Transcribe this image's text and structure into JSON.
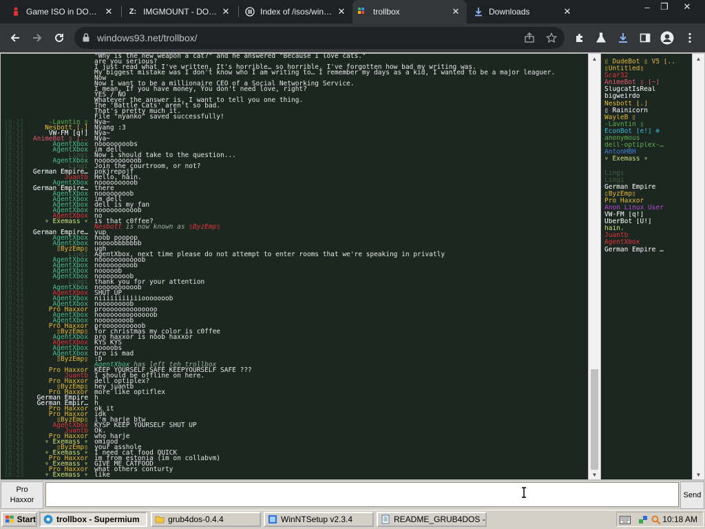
{
  "browser": {
    "tabs": [
      {
        "title": "Game ISO in DOSBox",
        "icon": "red-figure-icon",
        "active": false
      },
      {
        "title": "IMGMOUNT - DOSBox",
        "icon": "z-icon",
        "active": false
      },
      {
        "title": "Index of /isos/windows",
        "icon": "archive-icon",
        "active": false
      },
      {
        "title": "trollbox",
        "icon": "windows93-icon",
        "active": true
      },
      {
        "title": "Downloads",
        "icon": "download-icon",
        "active": false
      }
    ],
    "window_controls": {
      "minimize": "‒",
      "restore": "❐",
      "close": "✕"
    },
    "url": "windows93.net/trollbox/"
  },
  "chat": {
    "lines": [
      {
        "t": "",
        "nick": "",
        "nc": "#e7e7e7",
        "msg": "\"Why is the new weapon a cat?\" and he answered \"Because I love cats.\""
      },
      {
        "t": "",
        "nick": "",
        "nc": "#e7e7e7",
        "msg": "  are you serious?"
      },
      {
        "t": "",
        "nick": "",
        "nc": "#e7e7e7",
        "msg": "I just read what I've written, It's horrible… so horrible. I've forgotten how bad my writing was."
      },
      {
        "t": "",
        "nick": "",
        "nc": "#e7e7e7",
        "msg": "My biggest mistake was I don't know who I am writing to… I remember my days as a kid, I wanted to be a major leaguer."
      },
      {
        "t": "",
        "nick": "",
        "nc": "#e7e7e7",
        "msg": "Now"
      },
      {
        "t": "",
        "nick": "",
        "nc": "#e7e7e7",
        "msg": "Now I want to be a millionaire CEO of a Social Networking Service."
      },
      {
        "t": "",
        "nick": "",
        "nc": "#e7e7e7",
        "msg": "I mean, If you have money, You don't need love, right?"
      },
      {
        "t": "",
        "nick": "",
        "nc": "#e7e7e7",
        "msg": "YES / NO"
      },
      {
        "t": "",
        "nick": "",
        "nc": "#e7e7e7",
        "msg": "Whatever the answer is, I want to tell you one thing."
      },
      {
        "t": "",
        "nick": "",
        "nc": "#e7e7e7",
        "msg": "The 'Battle Cats' aren't so bad."
      },
      {
        "t": "",
        "nick": "",
        "nc": "#e7e7e7",
        "msg": "That's pretty much it."
      },
      {
        "t": "",
        "nick": "",
        "nc": "#e7e7e7",
        "msg": "File \"nyanko\" saved successfully!"
      },
      {
        "t": "10:21",
        "nick": "-Lavntin ▯",
        "nc": "#5fb14d",
        "msg": "Nya~"
      },
      {
        "t": "10:21",
        "nick": "Nesbott [.]",
        "nc": "#e3b93a",
        "msg": "Nyang :3"
      },
      {
        "t": "10:21",
        "nick": "VW-FM [q!]",
        "nc": "#ffffff",
        "msg": "Nya~"
      },
      {
        "t": "10:21",
        "nick": "AnimeBot ▯ [..",
        "nc": "#e2596a",
        "msg": "Nya~"
      },
      {
        "t": "10:21",
        "nick": "AgentXbox",
        "nc": "#4fbe8f",
        "msg": "noooooooobs"
      },
      {
        "t": "10:21",
        "nick": "AgentXbox",
        "nc": "#4fbe8f",
        "msg": "im dell"
      },
      {
        "t": "10:21",
        "nick": "Lingi",
        "nc": "#3f5f40",
        "msg": "Now i should take to the question..."
      },
      {
        "t": "10:21",
        "nick": "AgentXbox",
        "nc": "#4fbe8f",
        "msg": "noooooooooob"
      },
      {
        "t": "10:21",
        "nick": "Lingi",
        "nc": "#3f5f40",
        "msg": "Join the courtroom, or not?"
      },
      {
        "t": "10:21",
        "nick": "German Empire…",
        "nc": "#ffffff",
        "msg": "pokjrepojf"
      },
      {
        "t": "10:21",
        "nick": "Juantb",
        "nc": "#e2333b",
        "msg": "Hello, hain."
      },
      {
        "t": "10:21",
        "nick": "AgentXbox",
        "nc": "#4fbe8f",
        "msg": "nooooooooob"
      },
      {
        "t": "10:21",
        "nick": "German Empire…",
        "nc": "#ffffff",
        "msg": "there"
      },
      {
        "t": "10:21",
        "nick": "AgentXbox",
        "nc": "#4fbe8f",
        "msg": "noooooooob"
      },
      {
        "t": "10:21",
        "nick": "AgentXbox",
        "nc": "#4fbe8f",
        "msg": "im dell"
      },
      {
        "t": "10:21",
        "nick": "AgentXbox",
        "nc": "#4fbe8f",
        "msg": "dell is my fan"
      },
      {
        "t": "10:21",
        "nick": "AgentXbox",
        "nc": "#4fbe8f",
        "msg": "noooooooooob"
      },
      {
        "t": "10:21",
        "nick": "AgentXbox",
        "nc": "#e2333b",
        "msg": "no"
      },
      {
        "t": "10:21",
        "nick": "▿ Exemass ▿",
        "nc": "#cfe07a",
        "msg": "is that c0ffee?"
      },
      {
        "t": "10:21",
        "nick": "",
        "nc": "#e7e7e7",
        "msg": "",
        "sys": {
          "a": "Nesbott",
          "ac": "#e2333b",
          "text": " is now known as ",
          "b": "▯ByzEmp▯",
          "bc": "#e2333b"
        }
      },
      {
        "t": "10:21",
        "nick": "German Empire…",
        "nc": "#ffffff",
        "msg": "yup"
      },
      {
        "t": "10:21",
        "nick": "AgentXbox",
        "nc": "#4fbe8f",
        "msg": "noob poopop"
      },
      {
        "t": "10:21",
        "nick": "AgentXbox",
        "nc": "#4fbe8f",
        "msg": "noooobbbbbbb"
      },
      {
        "t": "10:21",
        "nick": "▯ByzEmp▯",
        "nc": "#e3b93a",
        "msg": "ugh"
      },
      {
        "t": "10:21",
        "nick": "Lingi",
        "nc": "#3f5f40",
        "msg": "AgentXbox, next time please do not attempt to enter rooms that we're speaking in privatly"
      },
      {
        "t": "10:21",
        "nick": "AgentXbox",
        "nc": "#4fbe8f",
        "msg": "nooooooooooob"
      },
      {
        "t": "10:21",
        "nick": "AgentXbox",
        "nc": "#4fbe8f",
        "msg": "nooooooooob"
      },
      {
        "t": "10:21",
        "nick": "AgentXbox",
        "nc": "#4fbe8f",
        "msg": "nooooob"
      },
      {
        "t": "10:21",
        "nick": "AgentXbox",
        "nc": "#4fbe8f",
        "msg": "noooooooob"
      },
      {
        "t": "10:21",
        "nick": "Lingi",
        "nc": "#3f5f40",
        "msg": "thank you for your attention"
      },
      {
        "t": "10:21",
        "nick": "AgentXbox",
        "nc": "#4fbe8f",
        "msg": "noooooooooob"
      },
      {
        "t": "10:22",
        "nick": "AgentXbox",
        "nc": "#e2333b",
        "msg": "SHUT UP"
      },
      {
        "t": "10:22",
        "nick": "AgentXbox",
        "nc": "#4fbe8f",
        "msg": "niiiiiiiiiiiooooooob"
      },
      {
        "t": "10:22",
        "nick": "AgentXbox",
        "nc": "#4fbe8f",
        "msg": "noooooooob"
      },
      {
        "t": "10:22",
        "nick": "Pro Haxxor",
        "nc": "#e3b93a",
        "msg": "proooooooooooooo"
      },
      {
        "t": "10:22",
        "nick": "AgentXbox",
        "nc": "#4fbe8f",
        "msg": "noooooooooooooob"
      },
      {
        "t": "10:22",
        "nick": "AgentXbox",
        "nc": "#4fbe8f",
        "msg": "noooooooob"
      },
      {
        "t": "10:22",
        "nick": "Pro Haxxor",
        "nc": "#e3b93a",
        "msg": "proooooooooob"
      },
      {
        "t": "10:22",
        "nick": "▯ByzEmp▯",
        "nc": "#e3b93a",
        "msg": "for christmas my color is c0ffee"
      },
      {
        "t": "10:22",
        "nick": "AgentXbox",
        "nc": "#4fbe8f",
        "msg": "pro haxxor is noob haxxor"
      },
      {
        "t": "10:22",
        "nick": "AgentXbox",
        "nc": "#e2333b",
        "msg": "KYS KYS"
      },
      {
        "t": "10:22",
        "nick": "AgentXbox",
        "nc": "#4fbe8f",
        "msg": "noooobs"
      },
      {
        "t": "10:22",
        "nick": "AgentXbox",
        "nc": "#4fbe8f",
        "msg": "bro is mad"
      },
      {
        "t": "10:22",
        "nick": "▯ByzEmp▯",
        "nc": "#e3b93a",
        "msg": ":D"
      },
      {
        "t": "10:22",
        "nick": "",
        "nc": "#e7e7e7",
        "msg": "",
        "sys": {
          "a": "AgentXbox",
          "ac": "#4fbe8f",
          "text": " has left teh trollbox",
          "b": "",
          "bc": "#e2333b"
        }
      },
      {
        "t": "10:22",
        "nick": "Pro Haxxor",
        "nc": "#e3b93a",
        "msg": "KEEP YOURSELF SAFE KEEPYOURSELF SAFE ???"
      },
      {
        "t": "10:22",
        "nick": "Juantb",
        "nc": "#e2333b",
        "msg": "I should be offline on here."
      },
      {
        "t": "10:22",
        "nick": "Pro Haxxor",
        "nc": "#e3b93a",
        "msg": "dell optiplex?"
      },
      {
        "t": "10:22",
        "nick": "▯ByzEmp▯",
        "nc": "#e3b93a",
        "msg": "hey juantb"
      },
      {
        "t": "10:22",
        "nick": "Pro Haxxor",
        "nc": "#e3b93a",
        "msg": "more like optiflex"
      },
      {
        "t": "10:22",
        "nick": "German Empire",
        "nc": "#ffffff",
        "msg": "h"
      },
      {
        "t": "10:22",
        "nick": "German Empir…",
        "nc": "#ffffff",
        "msg": "h"
      },
      {
        "t": "10:22",
        "nick": "Pro Haxxor",
        "nc": "#e3b93a",
        "msg": "ok it"
      },
      {
        "t": "10:22",
        "nick": "Pro Haxxor",
        "nc": "#e3b93a",
        "msg": "idk"
      },
      {
        "t": "10:22",
        "nick": "▯ByzEmp▯",
        "nc": "#e3b93a",
        "msg": "i'm harje btw"
      },
      {
        "t": "10:22",
        "nick": "AgentXbox",
        "nc": "#e2333b",
        "msg": "KYSP KEEP YOURSELF SHUT UP"
      },
      {
        "t": "10:22",
        "nick": "Juantb",
        "nc": "#e2333b",
        "msg": "Ok."
      },
      {
        "t": "10:22",
        "nick": "Pro Haxxor",
        "nc": "#e3b93a",
        "msg": "who harje"
      },
      {
        "t": "10:23",
        "nick": "▿ Exemass ▿",
        "nc": "#cfe07a",
        "msg": "omigod"
      },
      {
        "t": "10:23",
        "nick": "▯ByzEmp▯",
        "nc": "#e3b93a",
        "msg": "your asshole"
      },
      {
        "t": "10:23",
        "nick": "▿ Exemass ▿",
        "nc": "#cfe07a",
        "msg": "I need cat food QUICK"
      },
      {
        "t": "10:23",
        "nick": "Pro Haxxor",
        "nc": "#e3b93a",
        "msg": "im from estonia (im on collabvm)"
      },
      {
        "t": "10:23",
        "nick": "▿ Exemass ▿",
        "nc": "#cfe07a",
        "msg": "GIVE ME CATFOOD"
      },
      {
        "t": "10:23",
        "nick": "Pro Haxxor",
        "nc": "#e3b93a",
        "msg": "what others conturty"
      },
      {
        "t": "10:23",
        "nick": "▿ Exemass ▿",
        "nc": "#cfe07a",
        "msg": "like"
      }
    ]
  },
  "users": [
    {
      "name": "▯ DudeBot ▯ V5 [..",
      "c": "#e3b93a"
    },
    {
      "name": "▯Untitled▯",
      "c": "#e3b93a"
    },
    {
      "name": "Scar32",
      "c": "#e2333b"
    },
    {
      "name": "AnimeBot ▯ [~]",
      "c": "#e2596a"
    },
    {
      "name": "SlugcatIsReal",
      "c": "#ffffff"
    },
    {
      "name": "bigweirdo",
      "c": "#ffffff"
    },
    {
      "name": "Nesbott [.]",
      "c": "#e3b93a"
    },
    {
      "name": "▯ Rainicorn",
      "c": "#ffffff"
    },
    {
      "name": "WayleB ▯",
      "c": "#e3b93a"
    },
    {
      "name": "-Lavntin ▯",
      "c": "#5fb14d"
    },
    {
      "name": "EconBot [e!] ❄",
      "c": "#3fb6d8"
    },
    {
      "name": "anonymous",
      "c": "#5fb14d"
    },
    {
      "name": "dell-optiplex-…",
      "c": "#5fb14d"
    },
    {
      "name": "AntonHBH",
      "c": "#3f7fd8"
    },
    {
      "name": "▿ Exemass ▿",
      "c": "#cfe07a"
    },
    {
      "name": "",
      "c": "#6a4aa0"
    },
    {
      "name": "Lingi",
      "c": "#3f5f40"
    },
    {
      "name": "Lingi",
      "c": "#3f5f40"
    },
    {
      "name": "German Empire",
      "c": "#ffffff"
    },
    {
      "name": "▯ByzEmp▯",
      "c": "#e3b93a"
    },
    {
      "name": "Pro Haxxor",
      "c": "#e3b93a"
    },
    {
      "name": "Anon Linux User",
      "c": "#b04ad8"
    },
    {
      "name": "VW-FM [q!]",
      "c": "#ffffff"
    },
    {
      "name": "UberBot [U!]",
      "c": "#ffffff"
    },
    {
      "name": "hain.",
      "c": "#cfe07a"
    },
    {
      "name": "Juantb",
      "c": "#e2333b"
    },
    {
      "name": "AgentXbox",
      "c": "#e2333b"
    },
    {
      "name": "German Empire …",
      "c": "#ffffff"
    }
  ],
  "composer": {
    "nick_line1": "Pro",
    "nick_line2": "Haxxor",
    "input_value": "",
    "send_label": "Send"
  },
  "taskbar": {
    "start_label": "Start",
    "tasks": [
      {
        "label": "trollbox - Supermium",
        "active": true
      },
      {
        "label": "grub4dos-0.4.4",
        "active": false
      },
      {
        "label": "WinNTSetup v2.3.4",
        "active": false
      },
      {
        "label": "README_GRUB4DOS - …",
        "active": false
      }
    ],
    "clock": "10:18 AM"
  }
}
